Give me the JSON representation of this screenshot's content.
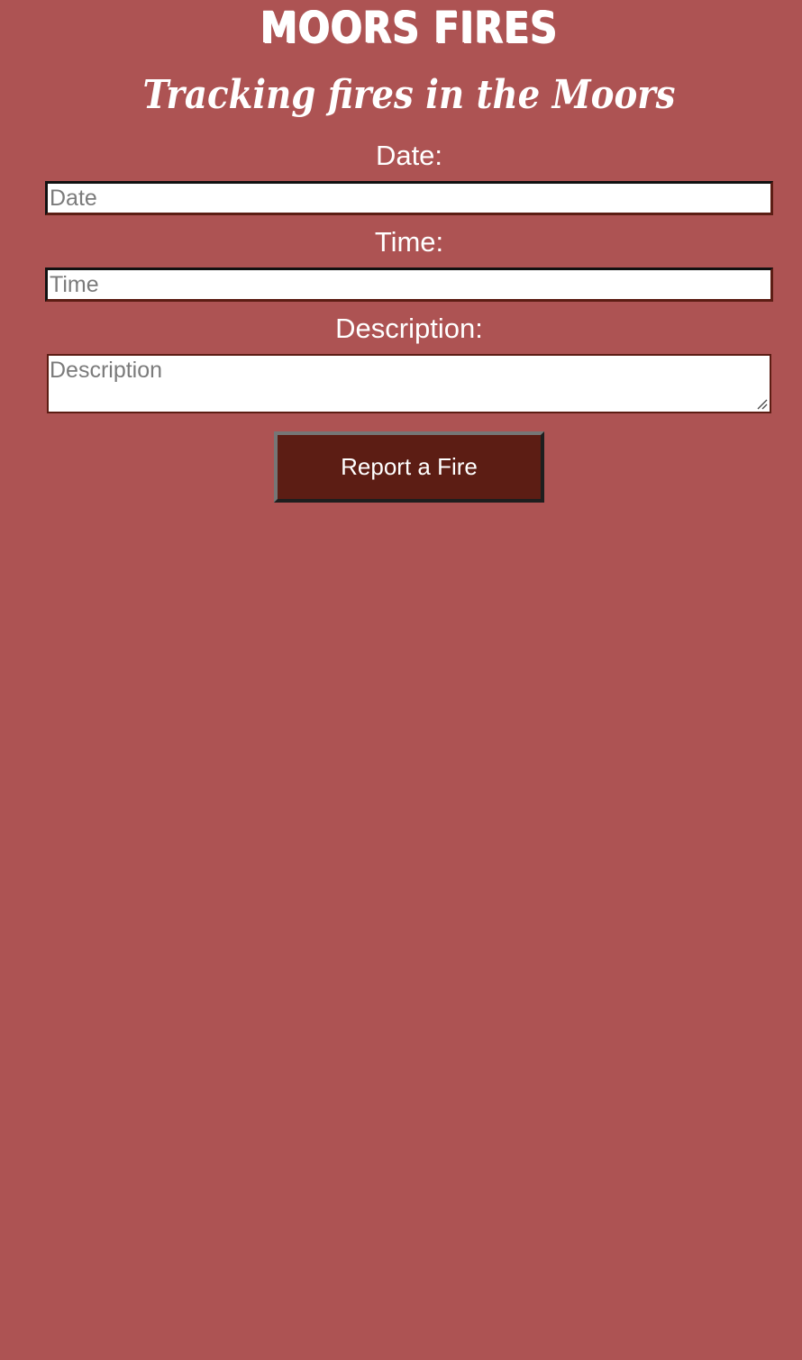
{
  "header": {
    "title": "Moors Fires",
    "subtitle": "Tracking fires in the Moors"
  },
  "form": {
    "date": {
      "label": "Date:",
      "placeholder": "Date",
      "value": ""
    },
    "time": {
      "label": "Time:",
      "placeholder": "Time",
      "value": ""
    },
    "description": {
      "label": "Description:",
      "placeholder": "Description",
      "value": ""
    },
    "submit_label": "Report a Fire"
  },
  "colors": {
    "background": "#ad5353",
    "button": "#5c1d14",
    "text": "#ffffff"
  },
  "icons": {
    "resize_grip": "resize-grip-icon"
  }
}
